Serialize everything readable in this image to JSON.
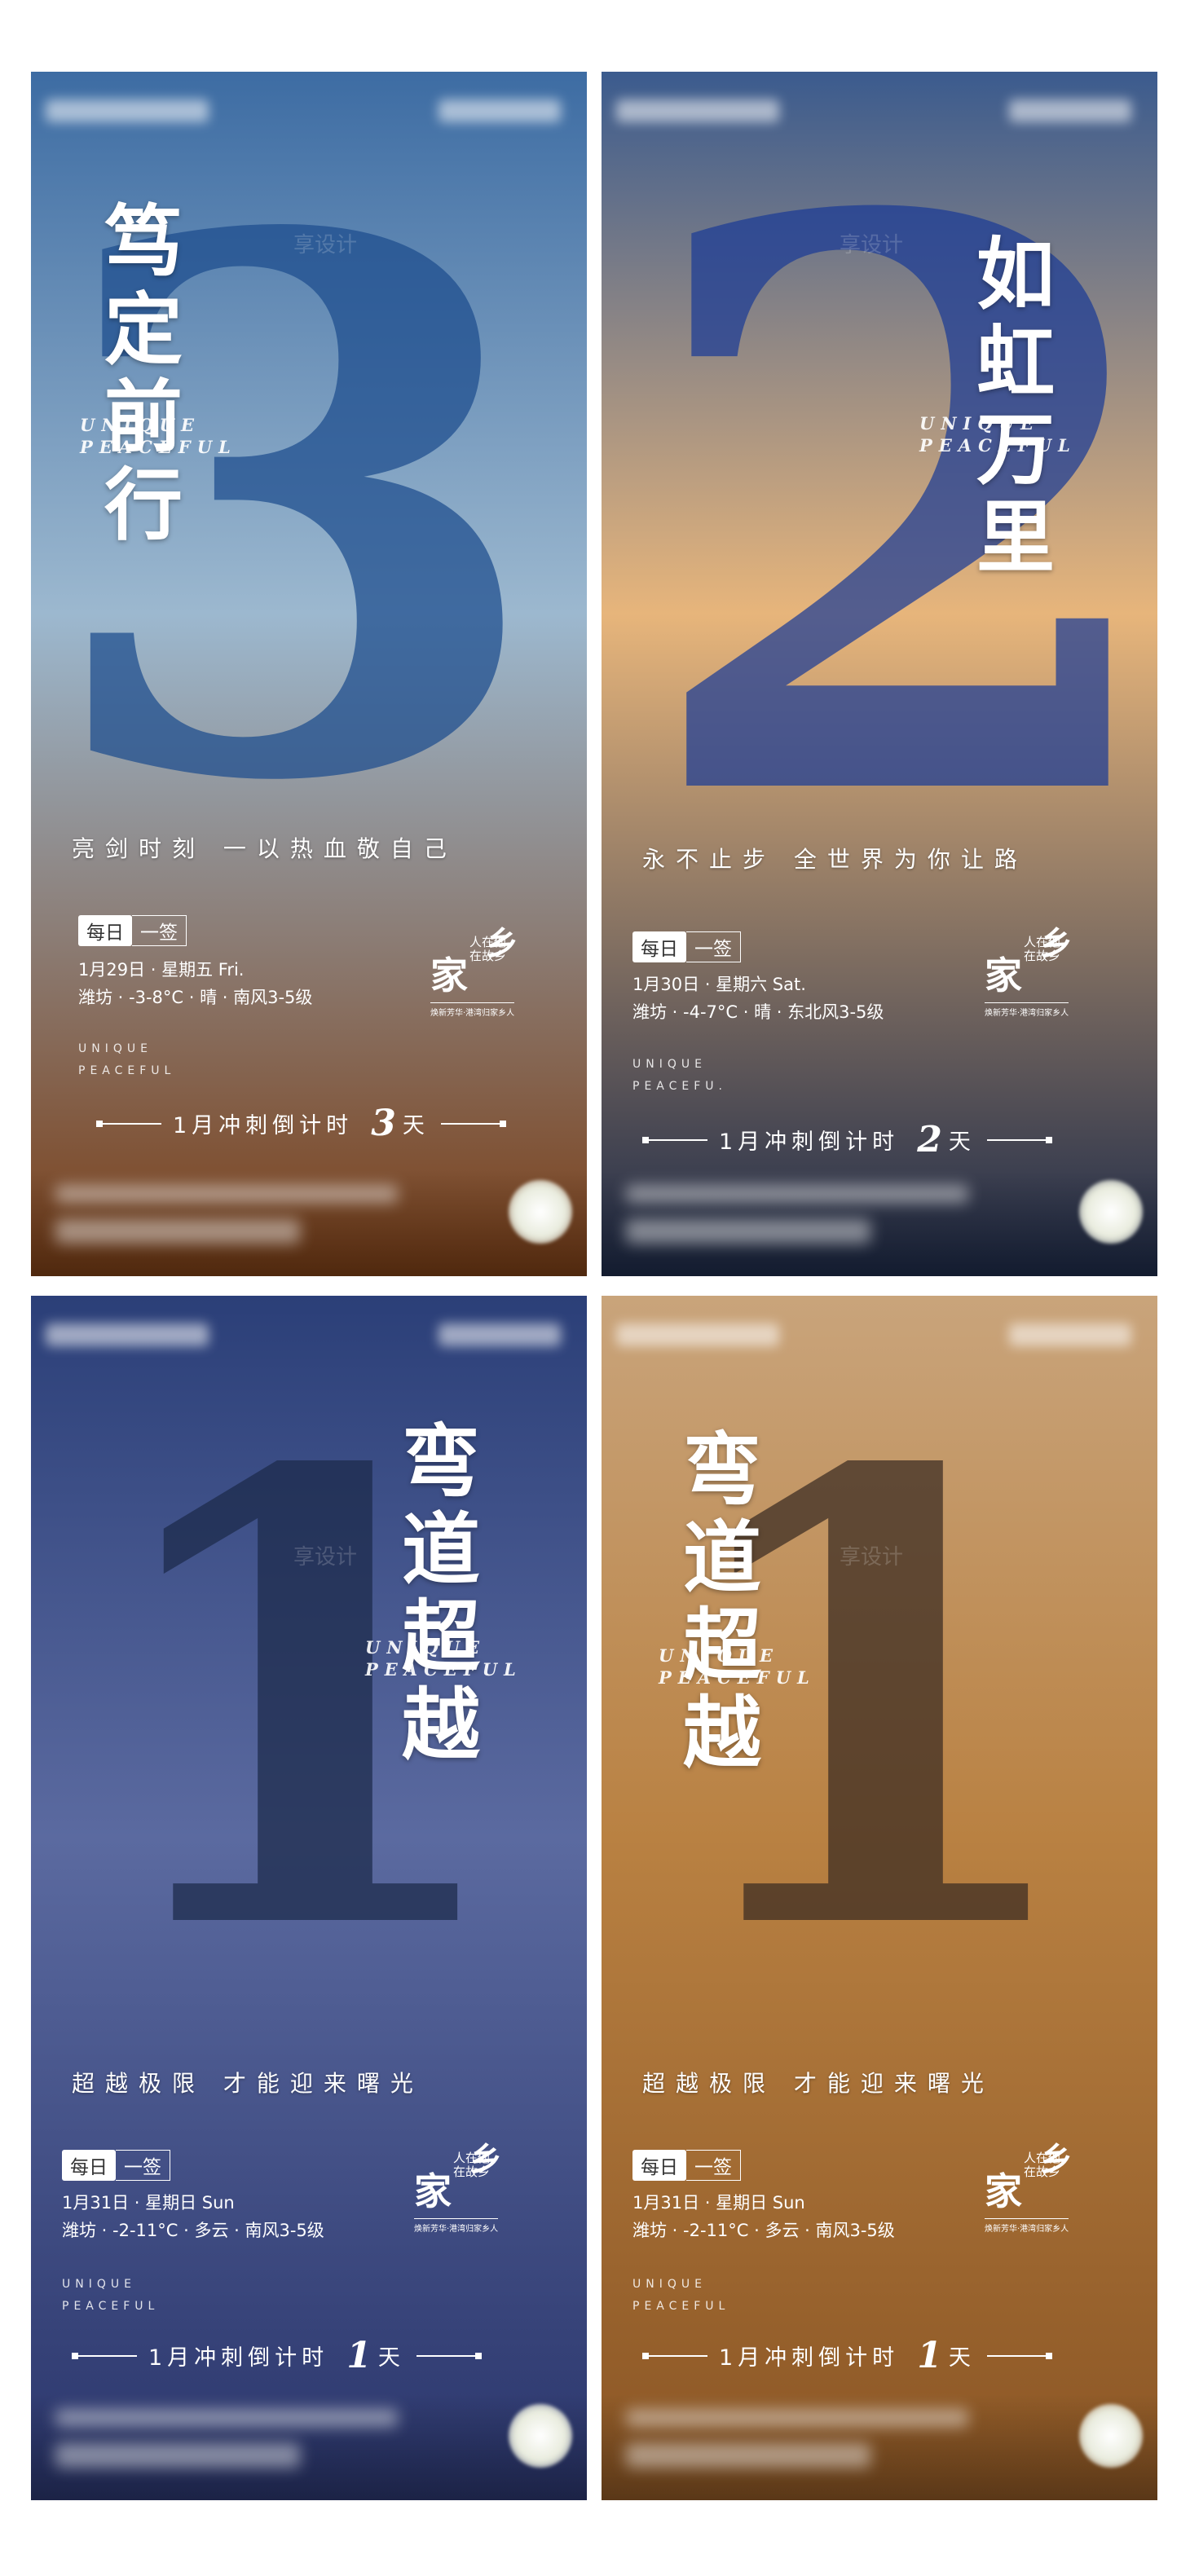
{
  "posters": [
    {
      "title_lines": [
        "笃",
        "定",
        "前",
        "行"
      ],
      "unique": "UNIQUE",
      "peaceful": "PEACEFUL",
      "slogan": "亮剑时刻 一以热血敬自己",
      "tag_a": "每日",
      "tag_b": "一签",
      "date": "1月29日 · 星期五 Fri.",
      "weather": "潍坊 · -3-8°C · 晴 · 南风3-5级",
      "en1": "UNIQUE",
      "en2": "PEACEFUL",
      "countdown_prefix": "1月冲刺倒计时",
      "countdown_num": "3",
      "countdown_suffix": "天",
      "digit": "3",
      "brand_big": "家",
      "brand_xiang": "乡",
      "brand_small": "人在他\n在故乡",
      "brand_foot": "焕新芳华·港湾归家乡人",
      "colors": {
        "top": "#3d6ca3",
        "mid": "#9cb8cf",
        "bottom": "#7a3e16",
        "digit": "#1d4d8e"
      }
    },
    {
      "title_lines": [
        "如",
        "虹",
        "万",
        "里"
      ],
      "unique": "UNIQUE",
      "peaceful": "PEACEFUL",
      "slogan": "永不止步 全世界为你让路",
      "tag_a": "每日",
      "tag_b": "一签",
      "date": "1月30日 · 星期六 Sat.",
      "weather": "潍坊 · -4-7°C · 晴 · 东北风3-5级",
      "en1": "UNIQUE",
      "en2": "PEACEFU.",
      "countdown_prefix": "1月冲刺倒计时",
      "countdown_num": "2",
      "countdown_suffix": "天",
      "digit": "2",
      "brand_big": "家",
      "brand_xiang": "乡",
      "brand_small": "人在他\n在故乡",
      "brand_foot": "焕新芳华·港湾归家乡人",
      "colors": {
        "top": "#3b5b8e",
        "mid": "#e7b57b",
        "bottom": "#1d2a48",
        "digit": "#1c3c96"
      }
    },
    {
      "title_lines": [
        "弯",
        "道",
        "超",
        "越"
      ],
      "unique": "UNIQUE",
      "peaceful": "PEACEFUL",
      "slogan": "超越极限 才能迎来曙光",
      "tag_a": "每日",
      "tag_b": "一签",
      "date": "1月31日 · 星期日 Sun",
      "weather": "潍坊 · -2-11°C · 多云 · 南风3-5级",
      "en1": "UNIQUE",
      "en2": "PEACEFUL",
      "countdown_prefix": "1月冲刺倒计时",
      "countdown_num": "1",
      "countdown_suffix": "天",
      "digit": "1",
      "brand_big": "家",
      "brand_xiang": "乡",
      "brand_small": "人在他\n在故乡",
      "brand_foot": "焕新芳华·港湾归家乡人",
      "colors": {
        "top": "#2b3f78",
        "mid": "#5b6aa0",
        "bottom": "#2a356b",
        "digit": "#1c2a4a"
      }
    },
    {
      "title_lines": [
        "弯",
        "道",
        "超",
        "越"
      ],
      "unique": "UNIQUE",
      "peaceful": "PEACEFUL",
      "slogan": "超越极限 才能迎来曙光",
      "tag_a": "每日",
      "tag_b": "一签",
      "date": "1月31日 · 星期日 Sun",
      "weather": "潍坊 · -2-11°C · 多云 · 南风3-5级",
      "en1": "UNIQUE",
      "en2": "PEACEFUL",
      "countdown_prefix": "1月冲刺倒计时",
      "countdown_num": "1",
      "countdown_suffix": "天",
      "digit": "1",
      "brand_big": "家",
      "brand_xiang": "乡",
      "brand_small": "人在他\n在故乡",
      "brand_foot": "焕新芳华·港湾归家乡人",
      "colors": {
        "top": "#c9a47b",
        "mid": "#b98142",
        "bottom": "#8a5524",
        "digit": "#3a2b22"
      }
    }
  ],
  "watermark": "享设计"
}
